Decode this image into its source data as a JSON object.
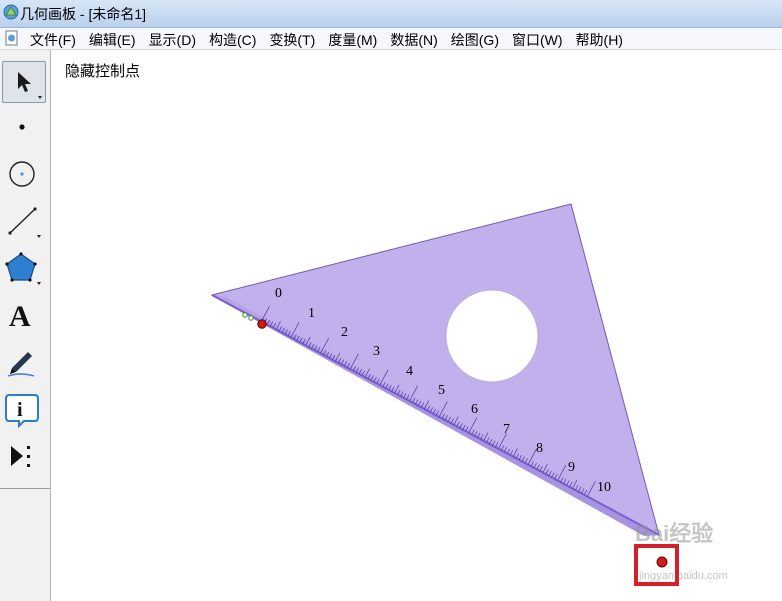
{
  "window": {
    "title": "几何画板 - [未命名1]"
  },
  "menu": {
    "items": [
      {
        "label": "文件(F)"
      },
      {
        "label": "编辑(E)"
      },
      {
        "label": "显示(D)"
      },
      {
        "label": "构造(C)"
      },
      {
        "label": "变换(T)"
      },
      {
        "label": "度量(M)"
      },
      {
        "label": "数据(N)"
      },
      {
        "label": "绘图(G)"
      },
      {
        "label": "窗口(W)"
      },
      {
        "label": "帮助(H)"
      }
    ]
  },
  "toolbar": {
    "tools": [
      {
        "icon": "arrow-select-icon"
      },
      {
        "icon": "point-tool-icon"
      },
      {
        "icon": "compass-tool-icon"
      },
      {
        "icon": "straightedge-tool-icon"
      },
      {
        "icon": "polygon-tool-icon"
      },
      {
        "icon": "text-tool-icon",
        "glyph": "A"
      },
      {
        "icon": "marker-tool-icon"
      },
      {
        "icon": "information-tool-icon",
        "glyph": "i"
      },
      {
        "icon": "custom-tool-icon"
      }
    ]
  },
  "canvas": {
    "action_button": "隐藏控制点",
    "ruler_ticks": [
      "0",
      "1",
      "2",
      "3",
      "4",
      "5",
      "6",
      "7",
      "8",
      "9",
      "10"
    ]
  },
  "watermark": {
    "text": "Bai经验",
    "sub": "jingyan.baidu.com"
  },
  "colors": {
    "triangle_fill": "#c2b0ec",
    "ruler_band": "#a893e2",
    "ruler_edge": "#7b5fd1",
    "highlight": "#d3202a",
    "point_red": "#d11a1a"
  }
}
